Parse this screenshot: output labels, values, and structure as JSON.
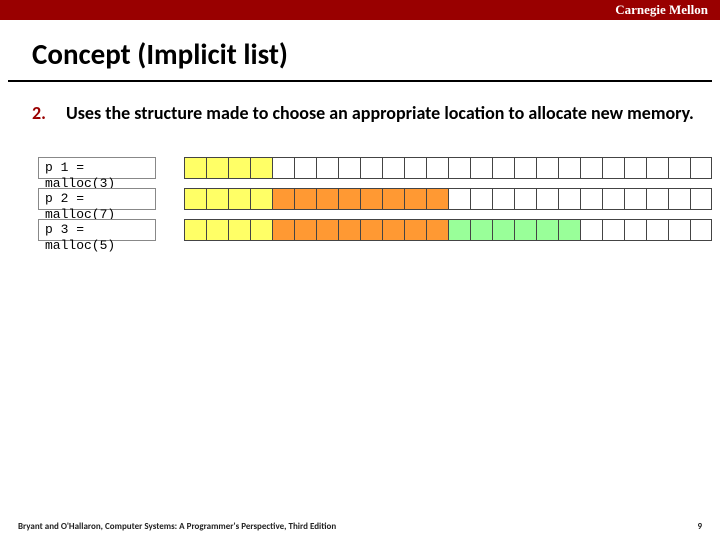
{
  "topbar": {
    "org": "Carnegie Mellon"
  },
  "title": "Concept (Implicit list)",
  "bullet": {
    "num": "2.",
    "text": "Uses the structure made to choose an appropriate location to allocate new memory."
  },
  "rows": [
    {
      "label": "p 1 = malloc(3)",
      "cells": [
        "yellow",
        "yellow",
        "yellow",
        "yellow",
        "empty",
        "empty",
        "empty",
        "empty",
        "empty",
        "empty",
        "empty",
        "empty",
        "empty",
        "empty",
        "empty",
        "empty",
        "empty",
        "empty",
        "empty",
        "empty",
        "empty",
        "empty",
        "empty",
        "empty"
      ]
    },
    {
      "label": "p 2 = malloc(7)",
      "cells": [
        "yellow",
        "yellow",
        "yellow",
        "yellow",
        "orange",
        "orange",
        "orange",
        "orange",
        "orange",
        "orange",
        "orange",
        "orange",
        "empty",
        "empty",
        "empty",
        "empty",
        "empty",
        "empty",
        "empty",
        "empty",
        "empty",
        "empty",
        "empty",
        "empty"
      ]
    },
    {
      "label": "p 3 = malloc(5)",
      "cells": [
        "yellow",
        "yellow",
        "yellow",
        "yellow",
        "orange",
        "orange",
        "orange",
        "orange",
        "orange",
        "orange",
        "orange",
        "orange",
        "green",
        "green",
        "green",
        "green",
        "green",
        "green",
        "empty",
        "empty",
        "empty",
        "empty",
        "empty",
        "empty"
      ]
    }
  ],
  "footer": {
    "credit": "Bryant and O'Hallaron, Computer Systems: A Programmer's Perspective, Third Edition",
    "page": "9"
  }
}
